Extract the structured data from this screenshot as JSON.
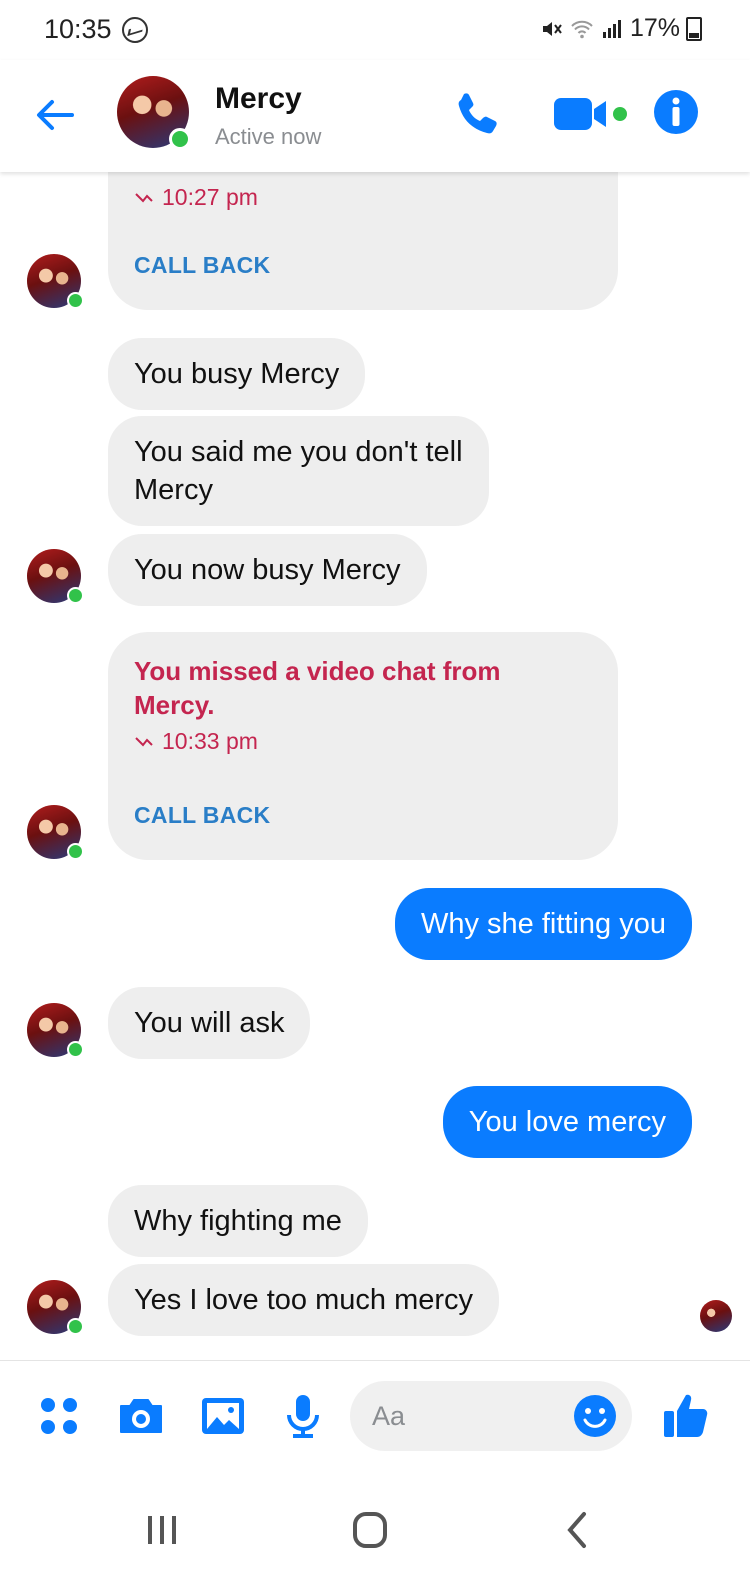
{
  "status_bar": {
    "time": "10:35",
    "battery": "17%"
  },
  "header": {
    "contact_name": "Mercy",
    "contact_status": "Active now",
    "accent_color": "#0a7cff"
  },
  "messages": {
    "card1": {
      "time": "10:27 pm",
      "action": "CALL BACK"
    },
    "m1": "You busy Mercy",
    "m2_line1": "You said me you don't tell",
    "m2_line2": "Mercy",
    "m3": "You now busy Mercy",
    "card2": {
      "text_line1": "You missed a video chat from",
      "text_line2": "Mercy.",
      "time": "10:33 pm",
      "action": "CALL BACK"
    },
    "m4": "Why she fitting you",
    "m5": "You will ask",
    "m6": "You love mercy",
    "m7": "Why fighting me",
    "m8": "Yes I love too much mercy"
  },
  "composer": {
    "placeholder": "Aa"
  },
  "colors": {
    "incoming_bubble": "#eeeeee",
    "outgoing_bubble": "#0a7cff",
    "missed_call": "#c4254f",
    "callback_link": "#2a7ec7",
    "presence": "#31c24a"
  }
}
